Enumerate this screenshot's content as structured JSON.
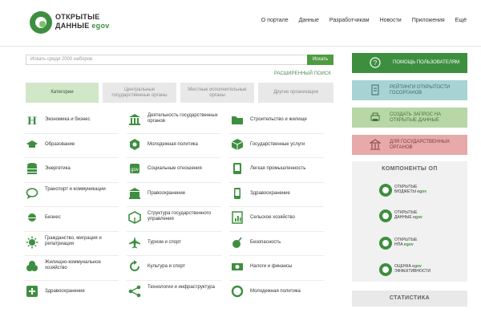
{
  "header": {
    "logo": {
      "line1": "ОТКРЫТЫЕ",
      "line2": "ДАННЫЕ",
      "gov": "gov"
    },
    "nav": [
      "О портале",
      "Данные",
      "Разработчикам",
      "Новости",
      "Приложения",
      "Ещё"
    ]
  },
  "search": {
    "placeholder": "Искать среди 2000 наборов",
    "button": "Искать",
    "advanced": "РАСШИРЕННЫЙ ПОИСК"
  },
  "tabs": [
    "Категории",
    "Центральные государственные органы",
    "Местные исполнительные органы",
    "Другие организации"
  ],
  "categories": [
    [
      "Экономика и бизнес",
      "Деятельность государственных органов",
      "Строительство и жилище"
    ],
    [
      "Образование",
      "Молодежная политика",
      "Государственные услуги"
    ],
    [
      "Энергетика",
      "Социальные отношения",
      "Легкая промышленность"
    ],
    [
      "Транспорт и коммуникации",
      "Правоохранение",
      "Здравоохранение"
    ],
    [
      "Бизнес",
      "Структура государственного управления",
      "Сельское хозяйство"
    ],
    [
      "Гражданство, миграция и репатриация",
      "Туризм и спорт",
      "Безопасность"
    ],
    [
      "Жилищно-коммунальное хозяйство",
      "Культура и спорт",
      "Налоги и финансы"
    ],
    [
      "Здравоохранение",
      "Технологии и инфраструктура",
      "Молодежная политика"
    ]
  ],
  "sidebar": {
    "help": "ПОМОЩЬ ПОЛЬЗОВАТЕЛЯМ",
    "blue": "РЕЙТИНГИ ОТКРЫТОСТИ ГОСОРГАНОВ",
    "green": "СОЗДАТЬ ЗАПРОС НА ОТКРЫТЫЕ ДАННЫЕ",
    "pink": "ДЛЯ ГОСУДАРСТВЕННЫХ ОРГАНОВ",
    "components_title": "КОМПОНЕНТЫ ОП",
    "components": [
      {
        "l1": "ОТКРЫТЫЕ",
        "l2": "БЮДЖЕТЫ",
        "gov": "gov"
      },
      {
        "l1": "ОТКРЫТЫЕ",
        "l2": "ДАННЫЕ",
        "gov": "gov"
      },
      {
        "l1": "ОТКРЫТЫЕ",
        "l2": "НПА",
        "gov": "gov"
      },
      {
        "l1": "ОЦЕНКА",
        "l2": "ЭФФЕКТИВНОСТИ",
        "gov": "gov"
      }
    ],
    "stats_title": "СТАТИСТИКА"
  },
  "colors": {
    "accent": "#3d8f3f",
    "light_accent": "#d1e7c8"
  }
}
